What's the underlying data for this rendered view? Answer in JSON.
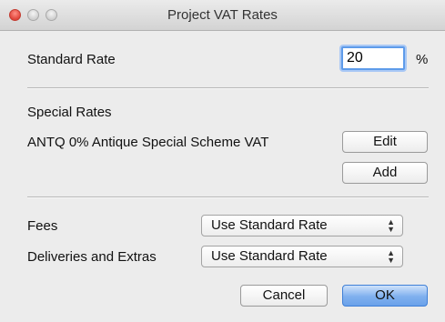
{
  "window": {
    "title": "Project VAT Rates"
  },
  "standard_rate": {
    "label": "Standard Rate",
    "value": "20",
    "unit": "%"
  },
  "special_rates": {
    "heading": "Special Rates",
    "items": [
      {
        "text": "ANTQ 0% Antique Special Scheme VAT",
        "edit_label": "Edit"
      }
    ],
    "add_label": "Add"
  },
  "fees": {
    "label": "Fees",
    "selected": "Use Standard Rate"
  },
  "deliveries": {
    "label": "Deliveries and Extras",
    "selected": "Use Standard Rate"
  },
  "actions": {
    "cancel_label": "Cancel",
    "ok_label": "OK"
  }
}
